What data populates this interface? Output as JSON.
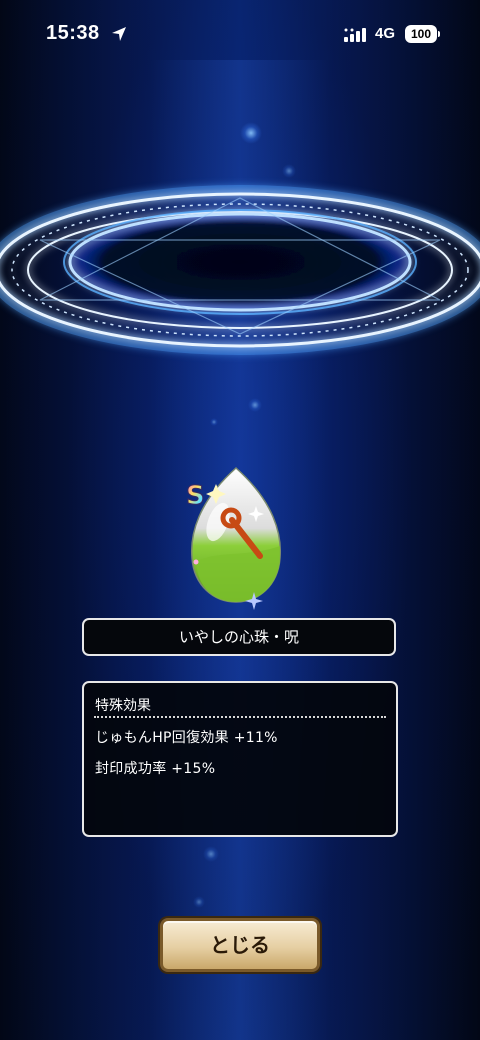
{
  "status_bar": {
    "time": "15:38",
    "network": "4G",
    "battery": "100"
  },
  "item": {
    "rank_badge": "S",
    "name": "いやしの心珠・呪"
  },
  "effects": {
    "title": "特殊効果",
    "lines": [
      "じゅもんHP回復効果 +11%",
      "封印成功率 +15%"
    ]
  },
  "close_button": {
    "label": "とじる"
  }
}
